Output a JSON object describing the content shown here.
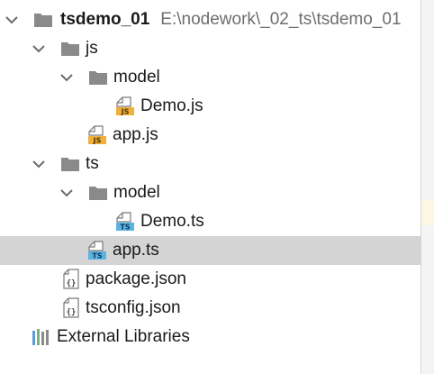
{
  "project": {
    "name": "tsdemo_01",
    "path": "E:\\nodework\\_02_ts\\tsdemo_01"
  },
  "tree": {
    "js_folder": "js",
    "js_model_folder": "model",
    "js_demo_file": "Demo.js",
    "js_app_file": "app.js",
    "ts_folder": "ts",
    "ts_model_folder": "model",
    "ts_demo_file": "Demo.ts",
    "ts_app_file": "app.ts",
    "package_file": "package.json",
    "tsconfig_file": "tsconfig.json",
    "external_libraries": "External Libraries"
  },
  "selected_item": "app.ts",
  "colors": {
    "folder": "#8a8a8a",
    "js_badge": "#f0b03c",
    "ts_badge": "#5bb3e3",
    "selection": "#d4d4d4",
    "path_text": "#6e6e6e"
  },
  "icons": {
    "folder": "folder-icon",
    "js_file": "js-file-icon",
    "ts_file": "ts-file-icon",
    "json_file": "json-file-icon",
    "libraries": "libraries-icon"
  }
}
